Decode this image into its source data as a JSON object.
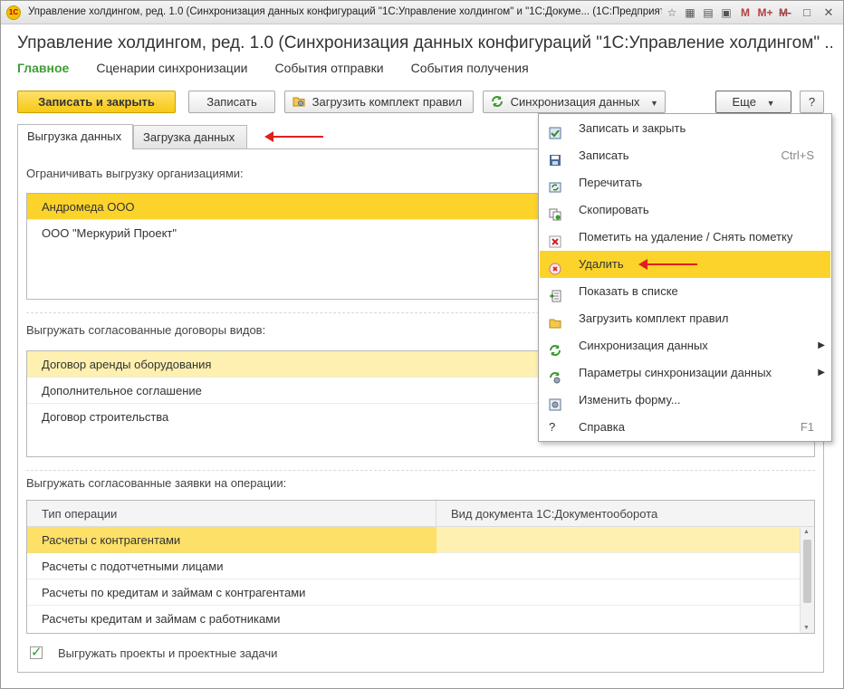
{
  "window": {
    "title": "Управление холдингом, ред. 1.0 (Синхронизация данных конфигураций \"1С:Управление холдингом\" и \"1С:Докуме... (1С:Предприятие)",
    "m_labels": [
      "M",
      "M+",
      "M-"
    ]
  },
  "form": {
    "title": "Управление холдингом, ред. 1.0 (Синхронизация данных конфигураций \"1С:Управление холдингом\" ...",
    "nav": [
      "Главное",
      "Сценарии синхронизации",
      "События отправки",
      "События получения"
    ]
  },
  "toolbar": {
    "save_close": "Записать и закрыть",
    "save": "Записать",
    "load_rules": "Загрузить комплект правил",
    "sync": "Синхронизация данных",
    "more": "Еще",
    "help": "?"
  },
  "tabs": [
    "Выгрузка данных",
    "Загрузка данных"
  ],
  "section1": {
    "label": "Ограничивать выгрузку организациями:",
    "items": [
      "Андромеда ООО",
      "ООО \"Меркурий Проект\""
    ]
  },
  "section2": {
    "label": "Выгружать согласованные договоры видов:",
    "items": [
      "Договор аренды оборудования",
      "Дополнительное соглашение",
      "Договор строительства"
    ]
  },
  "section3": {
    "label": "Выгружать согласованные заявки на операции:",
    "columns": [
      "Тип операции",
      "Вид документа 1С:Документооборота"
    ],
    "rows": [
      "Расчеты с контрагентами",
      "Расчеты с подотчетными лицами",
      "Расчеты по кредитам и займам с контрагентами",
      "Расчеты кредитам и займам с работниками"
    ]
  },
  "checkbox": {
    "label": "Выгружать проекты и проектные задачи",
    "checked": true
  },
  "menu": {
    "items": [
      {
        "label": "Записать и закрыть",
        "shortcut": "",
        "icon": "save-close-icon"
      },
      {
        "label": "Записать",
        "shortcut": "Ctrl+S",
        "icon": "floppy-icon"
      },
      {
        "label": "Перечитать",
        "shortcut": "",
        "icon": "reread-icon"
      },
      {
        "label": "Скопировать",
        "shortcut": "",
        "icon": "copy-icon"
      },
      {
        "label": "Пометить на удаление / Снять пометку",
        "shortcut": "",
        "icon": "mark-delete-icon"
      },
      {
        "label": "Удалить",
        "shortcut": "",
        "icon": "delete-icon"
      },
      {
        "label": "Показать в списке",
        "shortcut": "",
        "icon": "show-list-icon"
      },
      {
        "label": "Загрузить комплект правил",
        "shortcut": "",
        "icon": "folder-icon"
      },
      {
        "label": "Синхронизация данных",
        "shortcut": "",
        "icon": "sync-icon"
      },
      {
        "label": "Параметры синхронизации данных",
        "shortcut": "",
        "icon": "sync-params-icon"
      },
      {
        "label": "Изменить форму...",
        "shortcut": "",
        "icon": "gear-icon"
      },
      {
        "label": "Справка",
        "shortcut": "F1",
        "icon": "help-icon"
      }
    ]
  },
  "colors": {
    "accent": "#fbd32b",
    "nav_active": "#3c9e35",
    "annotation_arrow": "#e02020"
  }
}
